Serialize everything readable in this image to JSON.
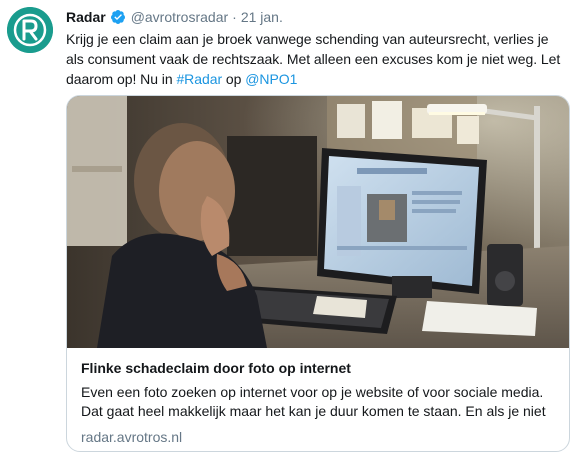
{
  "author": {
    "name": "Radar",
    "handle": "@avrotrosradar",
    "separator": "·",
    "date": "21 jan."
  },
  "tweet": {
    "text_before": "Krijg je een claim aan je broek vanwege schending van auteursrecht, verlies je als consument vaak de rechtszaak. Met alleen een excuses kom je niet weg. Let daarom op! Nu in ",
    "hashtag": "#Radar",
    "text_middle": " op ",
    "mention": "@NPO1"
  },
  "card": {
    "title": "Flinke schadeclaim door foto op internet",
    "description": "Even een foto zoeken op internet voor op je website of voor sociale media. Dat gaat heel makkelijk maar het  kan je duur komen te staan. En als je niet",
    "domain": "radar.avrotros.nl"
  },
  "colors": {
    "link": "#1b95e0",
    "verified": "#1da1f2",
    "avatar": "#1a9c8e",
    "secondary_text": "#657786",
    "card_border": "#ccd6dd"
  },
  "icons": {
    "avatar": "radar-logo-icon",
    "verified": "verified-badge-icon"
  }
}
